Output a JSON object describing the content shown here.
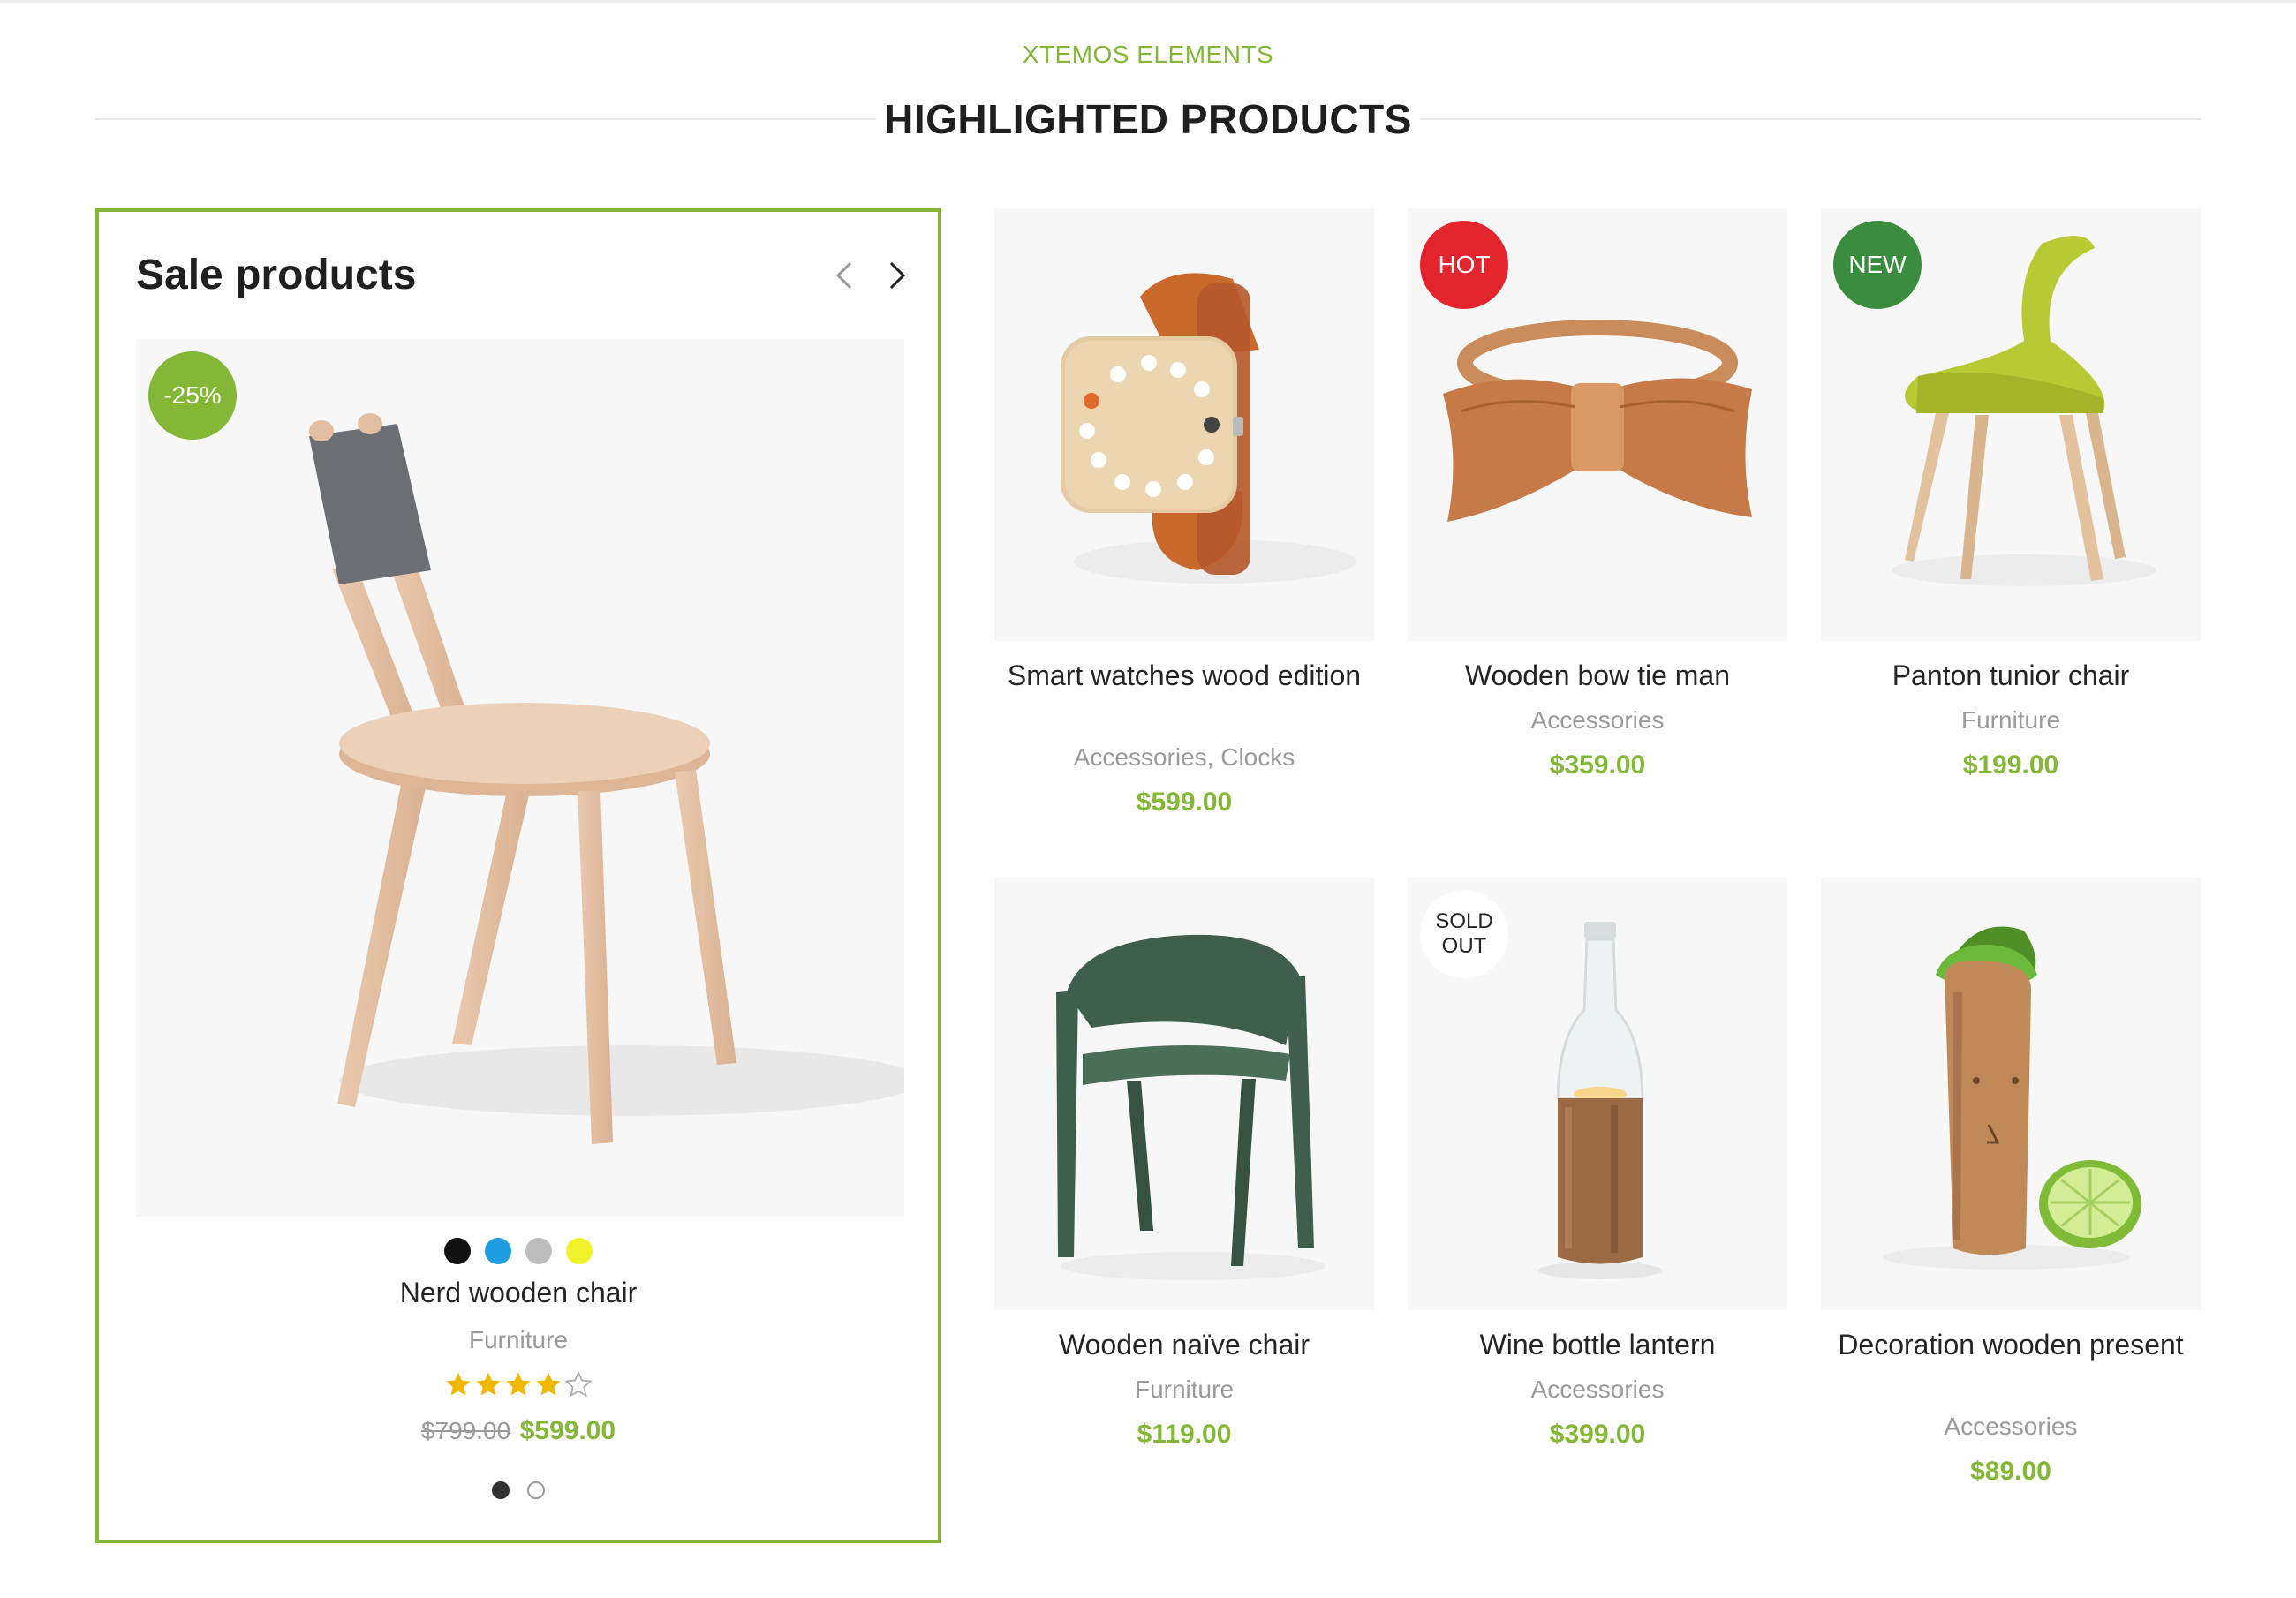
{
  "section": {
    "subtitle": "XTEMOS ELEMENTS",
    "title": "HIGHLIGHTED PRODUCTS"
  },
  "sale_box": {
    "title": "Sale products",
    "badge": "-25%",
    "swatches": [
      "#111111",
      "#1e9de0",
      "#bdbdbd",
      "#f2f22a"
    ],
    "product": {
      "name": "Nerd wooden chair",
      "category": "Furniture",
      "rating": 4,
      "rating_max": 5,
      "old_price": "$799.00",
      "price": "$599.00"
    },
    "pagination": {
      "pages": 2,
      "active": 1
    }
  },
  "products": [
    {
      "name": "Smart watches wood edition",
      "category": "Accessories, Clocks",
      "price": "$599.00",
      "badge": "",
      "icon": "wood-watch-image"
    },
    {
      "name": "Wooden bow tie man",
      "category": "Accessories",
      "price": "$359.00",
      "badge": "HOT",
      "icon": "bow-tie-image"
    },
    {
      "name": "Panton tunior chair",
      "category": "Furniture",
      "price": "$199.00",
      "badge": "NEW",
      "icon": "panton-chair-image"
    },
    {
      "name": "Wooden naïve chair",
      "category": "Furniture",
      "price": "$119.00",
      "badge": "",
      "icon": "green-chair-image"
    },
    {
      "name": "Wine bottle lantern",
      "category": "Accessories",
      "price": "$399.00",
      "badge": "SOLD OUT",
      "icon": "bottle-lantern-image"
    },
    {
      "name": "Decoration wooden present",
      "category": "Accessories",
      "price": "$89.00",
      "badge": "",
      "icon": "wooden-figure-image"
    }
  ],
  "colors": {
    "accent": "#83b735",
    "hot": "#e4252e",
    "new": "#3a8d3e",
    "star": "#f0b800"
  }
}
